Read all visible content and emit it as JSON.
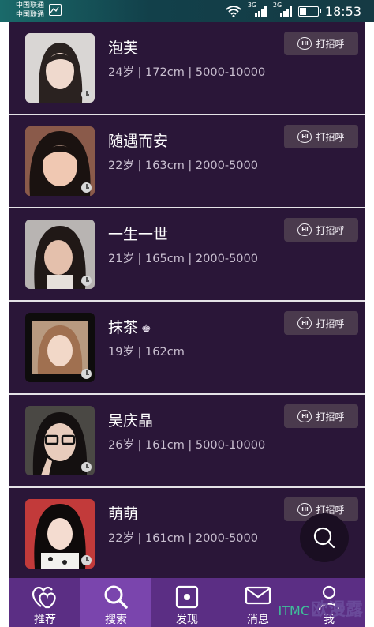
{
  "status_bar": {
    "carriers": [
      "中国联通",
      "中国联通"
    ],
    "net_labels": [
      "3G",
      "2G"
    ],
    "battery_level": 0.4,
    "time": "18:53"
  },
  "greet_label": "打招呼",
  "greet_icon_text": "HI",
  "users": [
    {
      "name": "泡芙",
      "info": "24岁 | 172cm | 5000-10000",
      "vip": false
    },
    {
      "name": "随遇而安",
      "info": "22岁 | 163cm | 2000-5000",
      "vip": false
    },
    {
      "name": "一生一世",
      "info": "21岁 | 165cm | 2000-5000",
      "vip": false
    },
    {
      "name": "抹茶",
      "info": "19岁 | 162cm",
      "vip": true
    },
    {
      "name": "吴庆晶",
      "info": "26岁 | 161cm | 5000-10000",
      "vip": false
    },
    {
      "name": "萌萌",
      "info": "22岁 | 161cm | 2000-5000",
      "vip": false
    }
  ],
  "tabs": [
    {
      "label": "推荐",
      "icon": "hearts-icon"
    },
    {
      "label": "搜索",
      "icon": "search-icon"
    },
    {
      "label": "发现",
      "icon": "discover-icon"
    },
    {
      "label": "消息",
      "icon": "mail-icon"
    },
    {
      "label": "我",
      "icon": "person-icon"
    }
  ],
  "active_tab": "搜索",
  "watermark": {
    "latin": "ITMC",
    "cjk": "欧漫露"
  },
  "colors": {
    "list_bg": "#2a1638",
    "tabbar": "#5b2e84",
    "tab_active": "#7a45ad",
    "status_bar": "#153a44"
  }
}
